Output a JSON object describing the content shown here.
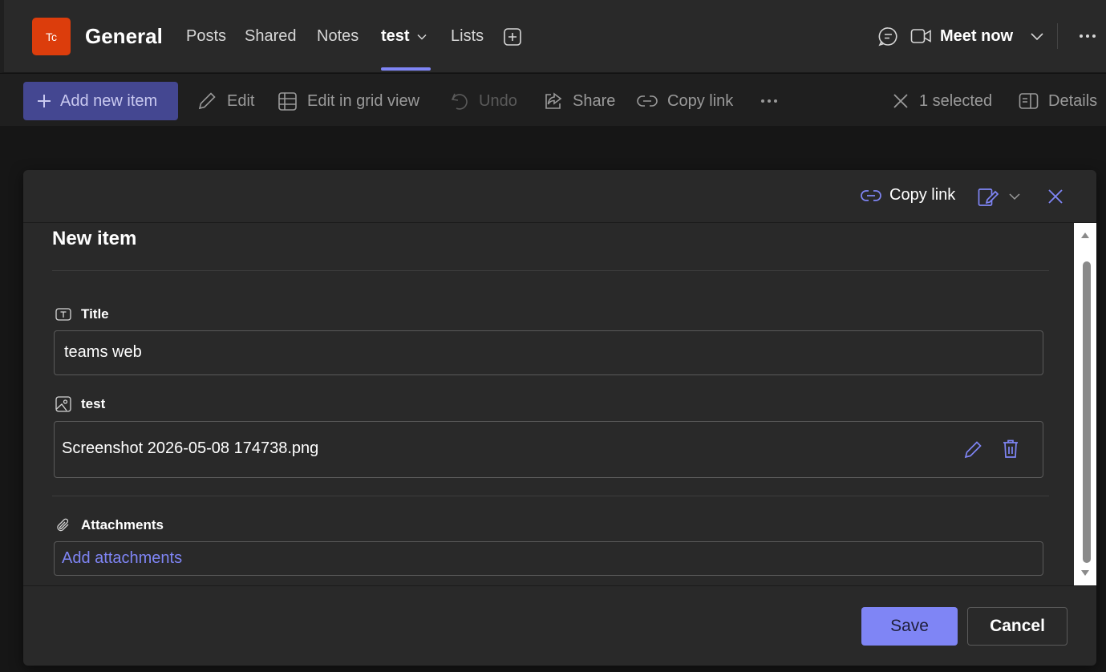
{
  "header": {
    "team_avatar": "Tc",
    "channel_name": "General",
    "tabs": [
      {
        "label": "Posts"
      },
      {
        "label": "Shared"
      },
      {
        "label": "Notes"
      },
      {
        "label": "test",
        "active": true
      },
      {
        "label": "Lists"
      }
    ],
    "meet_now_label": "Meet now",
    "icons": [
      "add-tab-icon",
      "chat-icon",
      "video-icon",
      "chevron-down-icon",
      "more-icon"
    ]
  },
  "toolbar": {
    "add_new_item": "Add new item",
    "edit": "Edit",
    "edit_grid": "Edit in grid view",
    "undo": "Undo",
    "share": "Share",
    "copy_link": "Copy link",
    "selected": "1 selected",
    "details": "Details"
  },
  "panel": {
    "copy_link": "Copy link",
    "title": "New item",
    "fields": {
      "title": {
        "label": "Title",
        "value": "teams web"
      },
      "test": {
        "label": "test",
        "file_name": "Screenshot 2026-05-08 174738.png"
      },
      "attachments": {
        "label": "Attachments",
        "action": "Add attachments"
      }
    },
    "save": "Save",
    "cancel": "Cancel"
  },
  "colors": {
    "accent": "#7f85f5",
    "add_button_bg": "#444791",
    "team_avatar_bg": "#dc3d0c",
    "panel_bg": "#292929"
  }
}
